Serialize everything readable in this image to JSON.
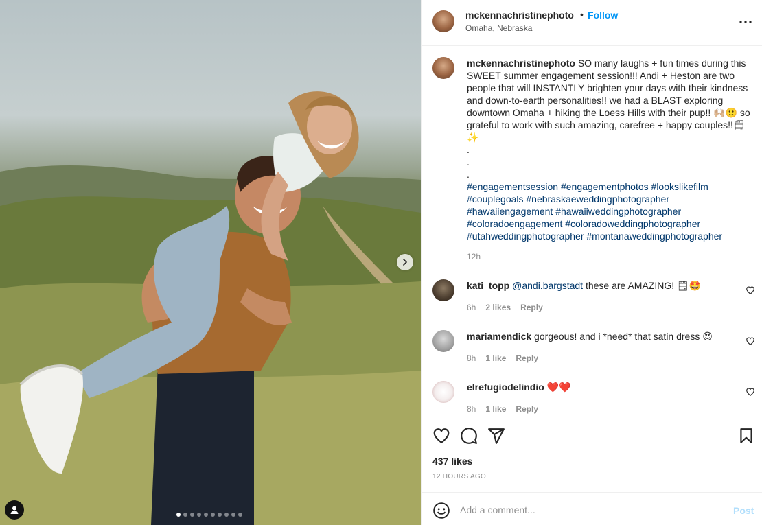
{
  "post": {
    "author": "mckennachristinephoto",
    "follow_label": "Follow",
    "separator": "•",
    "location": "Omaha, Nebraska"
  },
  "caption": {
    "username": "mckennachristinephoto",
    "text": "SO many laughs + fun times during this SWEET summer engagement session!!! Andi + Heston are two people that will INSTANTLY brighten your days with their kindness and down-to-earth personalities!! we had a BLAST exploring downtown Omaha + hiking the Loess Hills with their pup!! 🙌🏼🙂 so grateful to work with such amazing, carefree + happy couples!!🗒✨",
    "dots": [
      ".",
      ".",
      "."
    ],
    "hashtags": [
      "#engagementsession #engagementphotos #lookslikefilm",
      "#couplegoals #nebraskaeweddingphotographer",
      "#hawaiiengagement #hawaiiweddingphotographer",
      "#coloradoengagement #coloradoweddingphotographer",
      "#utahweddingphotographer #montanaweddingphotographer"
    ],
    "time": "12h"
  },
  "comments": [
    {
      "username": "kati_topp",
      "mention": "@andi.bargstadt",
      "text": " these are AMAZING! 🗒🤩",
      "time": "6h",
      "likes": "2 likes",
      "reply": "Reply"
    },
    {
      "username": "mariamendick",
      "mention": "",
      "text": " gorgeous! and i *need* that satin dress 😍",
      "time": "8h",
      "likes": "1 like",
      "reply": "Reply"
    },
    {
      "username": "elrefugiodelindio",
      "mention": "",
      "text": " ❤️❤️",
      "time": "8h",
      "likes": "1 like",
      "reply": "Reply"
    }
  ],
  "engagement": {
    "likes": "437 likes",
    "posted": "12 HOURS AGO"
  },
  "composer": {
    "placeholder": "Add a comment...",
    "post_label": "Post"
  },
  "carousel": {
    "count": 10,
    "active_index": 0
  },
  "icons": {
    "like": "heart-icon",
    "comment": "comment-icon",
    "share": "paper-plane-icon",
    "save": "bookmark-icon",
    "more": "more-options-icon",
    "emoji": "emoji-icon",
    "next": "chevron-right-icon",
    "tag": "user-tag-icon"
  },
  "colors": {
    "accent": "#0095f6",
    "hashtag": "#00376b",
    "post_disabled": "#b2dffc"
  }
}
